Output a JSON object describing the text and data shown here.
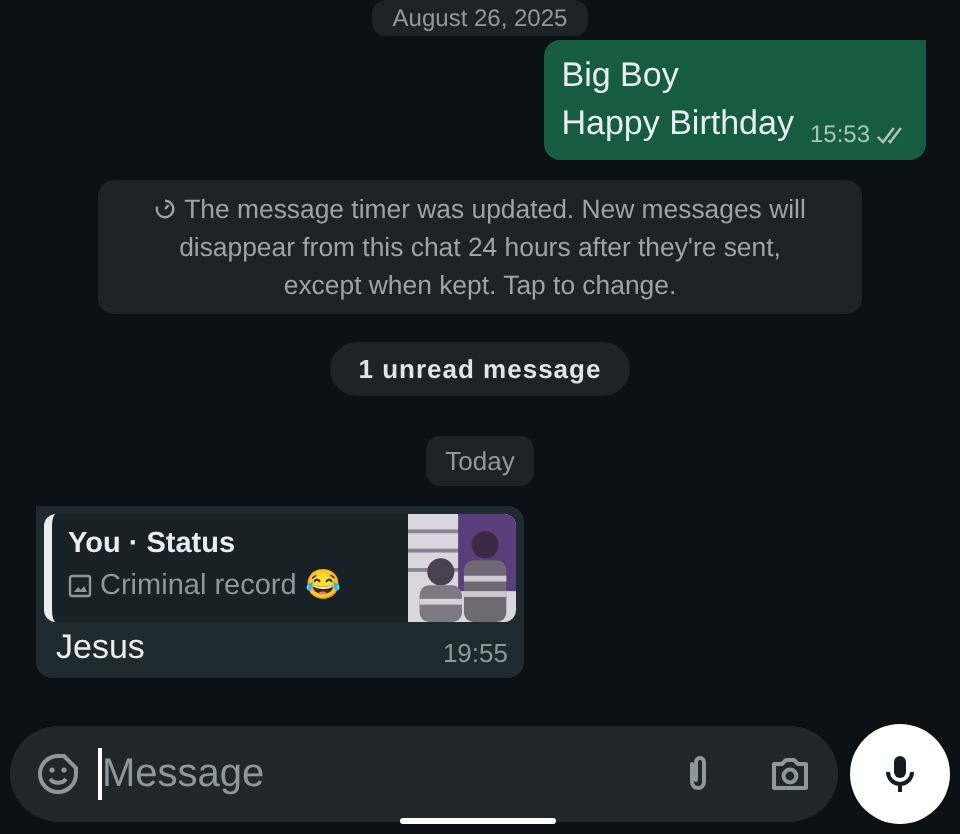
{
  "date_chip": "August 26, 2025",
  "messages": [
    {
      "kind": "outgoing",
      "lines": [
        "Big Boy",
        "Happy Birthday"
      ],
      "time": "15:53",
      "read": true
    },
    {
      "kind": "system",
      "text": "The message timer was updated. New messages will disappear from this chat 24 hours after they're sent, except when kept. Tap to change."
    },
    {
      "kind": "unread",
      "text": "1 unread message"
    },
    {
      "kind": "date",
      "text": "Today"
    },
    {
      "kind": "incoming",
      "quote": {
        "author": "You · Status",
        "caption": "Criminal record 😂"
      },
      "text": "Jesus",
      "time": "19:55"
    }
  ],
  "composer": {
    "placeholder": "Message"
  }
}
